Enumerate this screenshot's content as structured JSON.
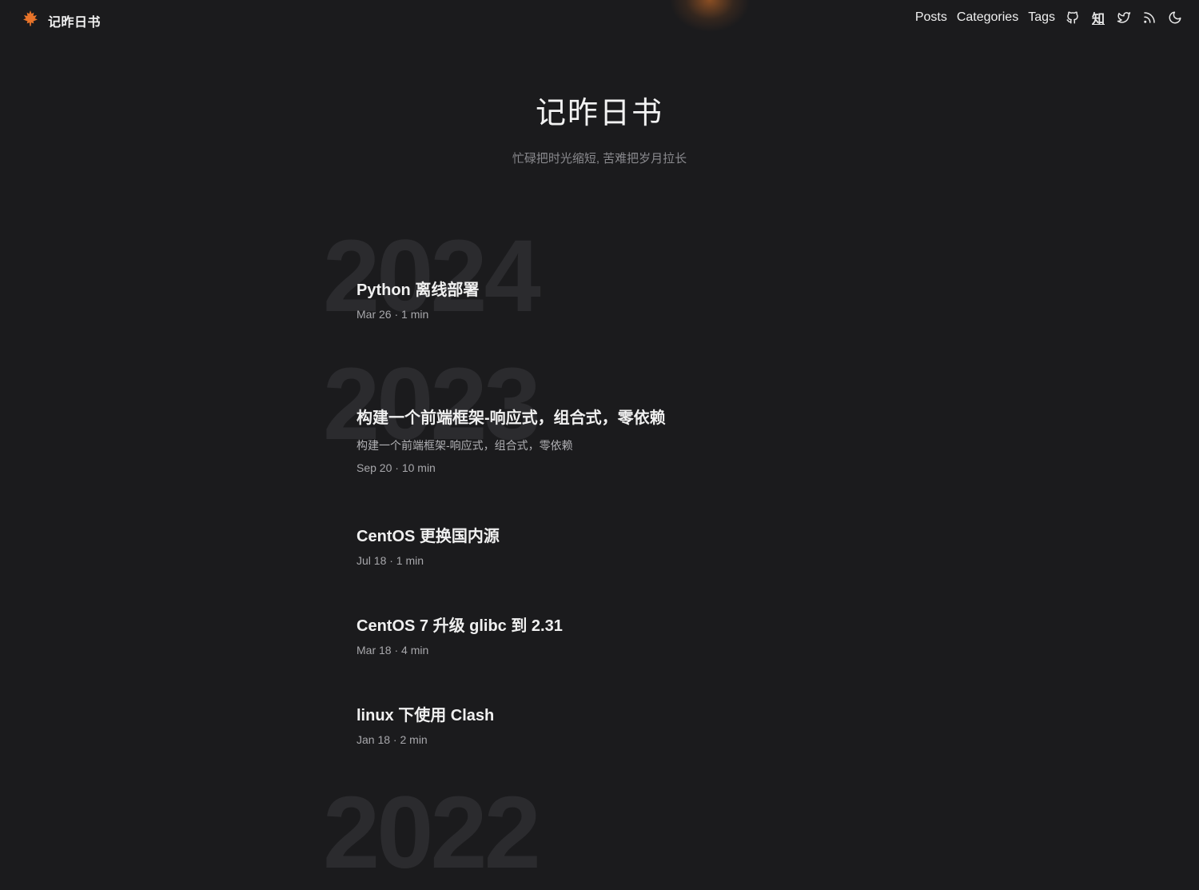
{
  "site": {
    "brand": "记昨日书",
    "title": "记昨日书",
    "subtitle": "忙碌把时光缩短, 苦难把岁月拉长",
    "accent": "#e8742a"
  },
  "nav": {
    "links": [
      "Posts",
      "Categories",
      "Tags"
    ],
    "zhihu_label": "知",
    "icons": [
      "github-icon",
      "zhihu-icon",
      "twitter-icon",
      "rss-icon",
      "moon-icon"
    ]
  },
  "years": [
    "2024",
    "2023",
    "2022"
  ],
  "posts": [
    {
      "title": "Python 离线部署",
      "meta": "Mar 26 · 1 min"
    },
    {
      "title": "构建一个前端框架-响应式，组合式，零依赖",
      "desc": "构建一个前端框架-响应式，组合式，零依赖",
      "meta": "Sep 20 · 10 min"
    },
    {
      "title": "CentOS 更换国内源",
      "meta": "Jul 18 · 1 min"
    },
    {
      "title": "CentOS 7 升级 glibc 到 2.31",
      "meta": "Mar 18 · 4 min"
    },
    {
      "title": "linux 下使用 Clash",
      "meta": "Jan 18 · 2 min"
    }
  ]
}
